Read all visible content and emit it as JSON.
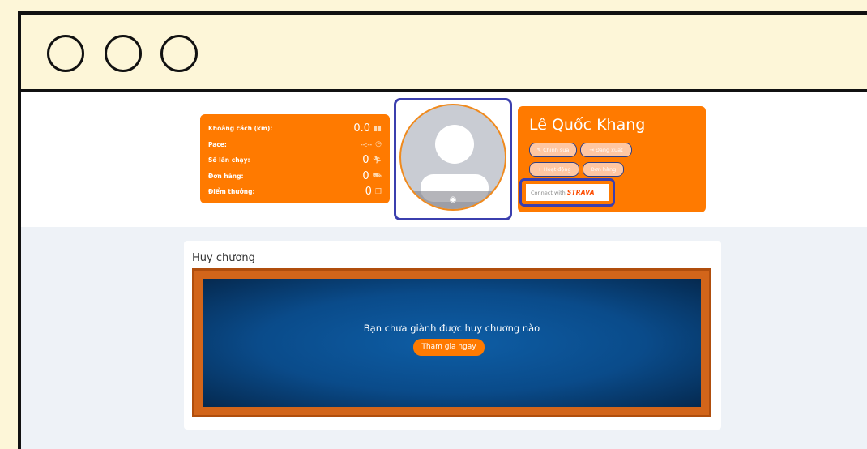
{
  "stats": [
    {
      "label": "Khoảng cách (km):",
      "value": "0.0",
      "icon": "chart-icon"
    },
    {
      "label": "Pace:",
      "value": "--:--",
      "icon": "clock-icon"
    },
    {
      "label": "Số lần chạy:",
      "value": "0",
      "icon": "runner-icon"
    },
    {
      "label": "Đơn hàng:",
      "value": "0",
      "icon": "cart-icon"
    },
    {
      "label": "Điểm thưởng:",
      "value": "0",
      "icon": "gift-icon"
    }
  ],
  "profile": {
    "name": "Lê Quốc Khang",
    "buttons": {
      "edit": "Chỉnh sửa",
      "logout": "Đăng xuất",
      "activity": "+ Hoạt động",
      "orders": "Đơn hàng"
    },
    "strava_prefix": "Connect with",
    "strava_brand": "STRAVA"
  },
  "medals": {
    "title": "Huy chương",
    "empty_message": "Bạn chưa giành được huy chương nào",
    "cta": "Tham gia ngay"
  },
  "colors": {
    "accent": "#ff7a00",
    "highlight_border": "#3b3fae",
    "panel_blue": "#0a4b8a"
  }
}
